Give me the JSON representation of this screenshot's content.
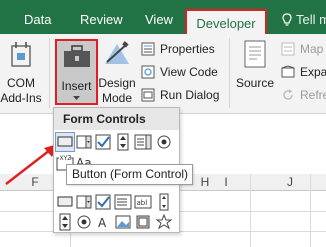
{
  "tabs": {
    "data": "Data",
    "review": "Review",
    "view": "View",
    "developer": "Developer",
    "tell_me": "Tell me"
  },
  "ribbon": {
    "com_addins": "COM Add-Ins",
    "insert": "Insert",
    "design_mode": "Design Mode",
    "properties": "Properties",
    "view_code": "View Code",
    "run_dialog": "Run Dialog",
    "source": "Source",
    "map_properties": "Map Pr",
    "expansion_packs": "Expar",
    "refresh_data": "Refres"
  },
  "grid": {
    "columns": [
      "F",
      "G",
      "H",
      "I",
      "J"
    ]
  },
  "dropdown": {
    "form_controls": "Form Controls",
    "tooltip": "Button (Form Control)"
  },
  "colors": {
    "tab_bar": "#217346",
    "highlight_border": "#e02020",
    "ribbon_bg": "#f3f3f3"
  }
}
